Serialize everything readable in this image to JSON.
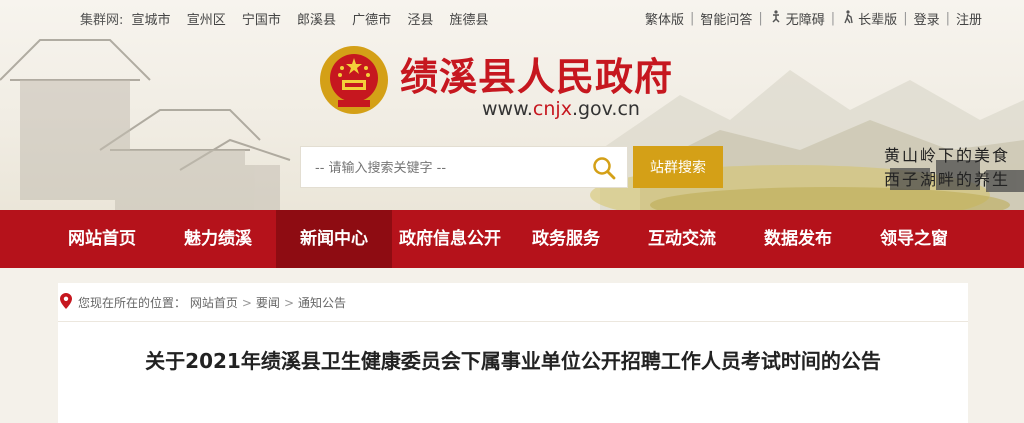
{
  "topbar": {
    "cluster_label": "集群网:",
    "cluster_links": [
      "宣城市",
      "宣州区",
      "宁国市",
      "郎溪县",
      "广德市",
      "泾县",
      "旌德县"
    ],
    "right_links": {
      "traditional": "繁体版",
      "smart_qa": "智能问答",
      "accessible": "无障碍",
      "elder": "长辈版",
      "login": "登录",
      "register": "注册"
    }
  },
  "header": {
    "title": "绩溪县人民政府",
    "url_prefix": "www.",
    "url_highlight": "cnjx",
    "url_suffix": ".gov.cn",
    "slogan_line1": "黄山岭下的美食",
    "slogan_line2": "西子湖畔的养生"
  },
  "search": {
    "placeholder": "-- 请输入搜索关键字 --",
    "button_label": "站群搜索"
  },
  "nav": {
    "items": [
      "网站首页",
      "魅力绩溪",
      "新闻中心",
      "政府信息公开",
      "政务服务",
      "互动交流",
      "数据发布",
      "领导之窗"
    ],
    "active": "新闻中心"
  },
  "breadcrumb": {
    "prefix": "您现在所在的位置：",
    "items": [
      "网站首页",
      "要闻",
      "通知公告"
    ]
  },
  "article": {
    "title": "关于2021年绩溪县卫生健康委员会下属事业单位公开招聘工作人员考试时间的公告"
  },
  "colors": {
    "brand_red": "#c6171f",
    "nav_red": "#b5121b",
    "nav_active": "#8e0c12",
    "search_gold": "#d4a017"
  }
}
